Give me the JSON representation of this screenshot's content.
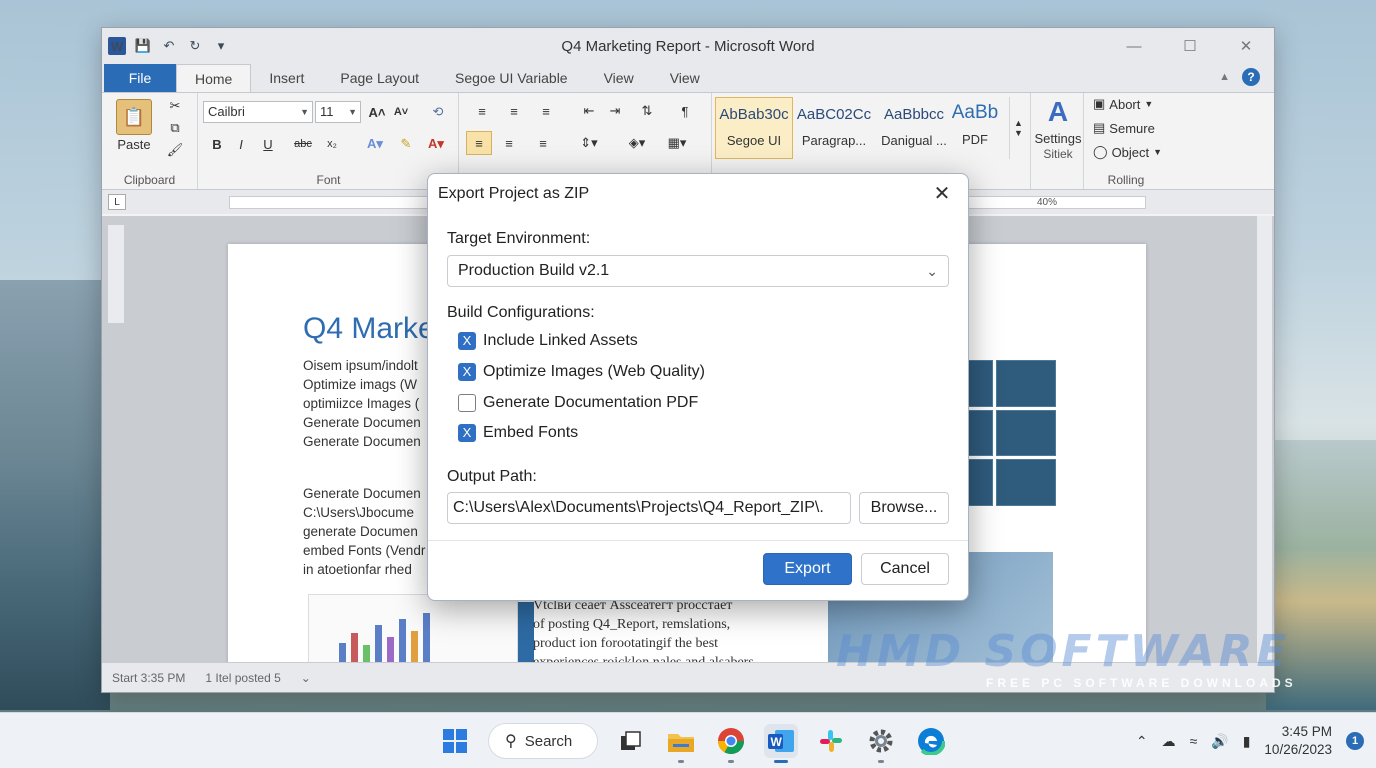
{
  "word": {
    "title": "Q4 Marketing Report  -  Microsoft Word",
    "tabs": [
      "File",
      "Home",
      "Insert",
      "Page Layout",
      "Segoe UI Variable",
      "View",
      "View"
    ],
    "font_name": "Cailbri",
    "font_size": "11",
    "groups": {
      "clipboard": "Clipboard",
      "font": "Font",
      "rolling": "Rolling"
    },
    "paste_label": "Paste",
    "styles": [
      {
        "sample": "AbBab30c",
        "name": "Segoe UI"
      },
      {
        "sample": "AaBC02Cc",
        "name": "Paragrap..."
      },
      {
        "sample": "AaBbbcc",
        "name": "Danigual ..."
      },
      {
        "sample": "AaBb",
        "name": "PDF"
      }
    ],
    "settings_label": "Settings",
    "settings_sub": "Sitiek",
    "right_items": [
      "Abort",
      "Semure",
      "Object"
    ],
    "ruler_zoom": "40%",
    "status": [
      "Start 3:35 PM",
      "1 Itel posted 5"
    ],
    "document": {
      "heading": "Q4 Marke",
      "para1": "Oisem ipsum/indolt\nOptimize imags (W\noptimiizce Images (\nGenerate Documen\nGenerate Documen",
      "para2": "Generate Documen\nC:\\Users\\Jbocume\ngenerate Documen\nembed Fonts (Vendr\nin atoetionfar rhed",
      "para3": "Vtclви сеает Assceатегт proсстает\nof posting Q4_Report, remslations,\nproduct ion forootatingif the best\nexperiences roicklon nales and alsabers"
    }
  },
  "dialog": {
    "title": "Export Project as ZIP",
    "target_label": "Target Environment:",
    "target_value": "Production Build v2.1",
    "build_label": "Build Configurations:",
    "options": [
      {
        "label": "Include Linked Assets",
        "checked": true
      },
      {
        "label": "Optimize Images (Web Quality)",
        "checked": true
      },
      {
        "label": "Generate Documentation PDF",
        "checked": false
      },
      {
        "label": "Embed Fonts",
        "checked": true
      }
    ],
    "check_mark": "X",
    "output_label": "Output Path:",
    "output_value": "C:\\Users\\Alex\\Documents\\Projects\\Q4_Report_ZIP\\.",
    "browse": "Browse...",
    "export": "Export",
    "cancel": "Cancel"
  },
  "watermark": {
    "brand": "HMD SOFTWARE",
    "tagline": "FREE PC SOFTWARE DOWNLOADS"
  },
  "taskbar": {
    "search": "Search",
    "time": "3:45 PM",
    "date": "10/26/2023",
    "badge": "1"
  },
  "colors": {
    "accent": "#2f72c9",
    "file_tab": "#2b6cb7",
    "heading": "#2f6db0"
  }
}
